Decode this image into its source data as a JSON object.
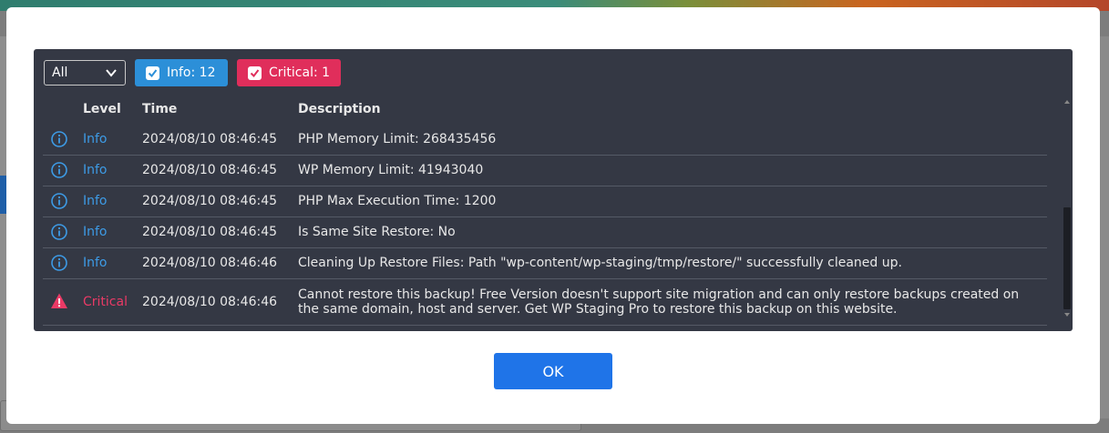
{
  "filter": {
    "selected": "All",
    "info_chip": "Info: 12",
    "critical_chip": "Critical: 1"
  },
  "columns": {
    "level": "Level",
    "time": "Time",
    "description": "Description"
  },
  "rows": [
    {
      "level": "Info",
      "time": "2024/08/10 08:46:45",
      "description": "PHP Memory Limit: 268435456"
    },
    {
      "level": "Info",
      "time": "2024/08/10 08:46:45",
      "description": "WP Memory Limit: 41943040"
    },
    {
      "level": "Info",
      "time": "2024/08/10 08:46:45",
      "description": "PHP Max Execution Time: 1200"
    },
    {
      "level": "Info",
      "time": "2024/08/10 08:46:45",
      "description": "Is Same Site Restore: No"
    },
    {
      "level": "Info",
      "time": "2024/08/10 08:46:46",
      "description": "Cleaning Up Restore Files: Path \"wp-content/wp-staging/tmp/restore/\" successfully cleaned up."
    },
    {
      "level": "Critical",
      "time": "2024/08/10 08:46:46",
      "description_line1": "Cannot restore this backup! Free Version doesn't support site migration and can only restore backups created on",
      "description_line2": "the same domain, host and server. Get WP Staging Pro to restore this backup on this website."
    }
  ],
  "ok_button": "OK",
  "colors": {
    "info": "#3d9be6",
    "critical": "#ea3a66",
    "panel": "#343844",
    "ok": "#1f74e8"
  }
}
